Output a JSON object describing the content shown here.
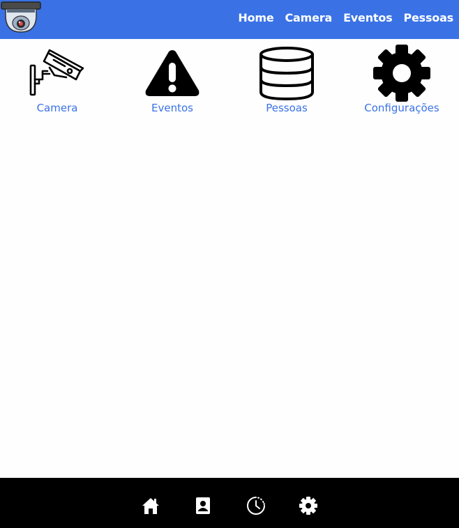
{
  "topbar": {
    "color": "#3a72e6",
    "logo_icon": "security-camera-dome-icon",
    "nav": [
      "Home",
      "Camera",
      "Eventos",
      "Pessoas"
    ]
  },
  "shortcuts": [
    {
      "label": "Camera",
      "icon": "cctv-camera-icon"
    },
    {
      "label": "Eventos",
      "icon": "warning-icon"
    },
    {
      "label": "Pessoas",
      "icon": "database-icon"
    },
    {
      "label": "Configurações",
      "icon": "gear-icon"
    }
  ],
  "bottombar": {
    "color": "#000000",
    "icons": [
      "home-icon",
      "contact-book-icon",
      "history-clock-icon",
      "settings-gear-icon"
    ]
  }
}
